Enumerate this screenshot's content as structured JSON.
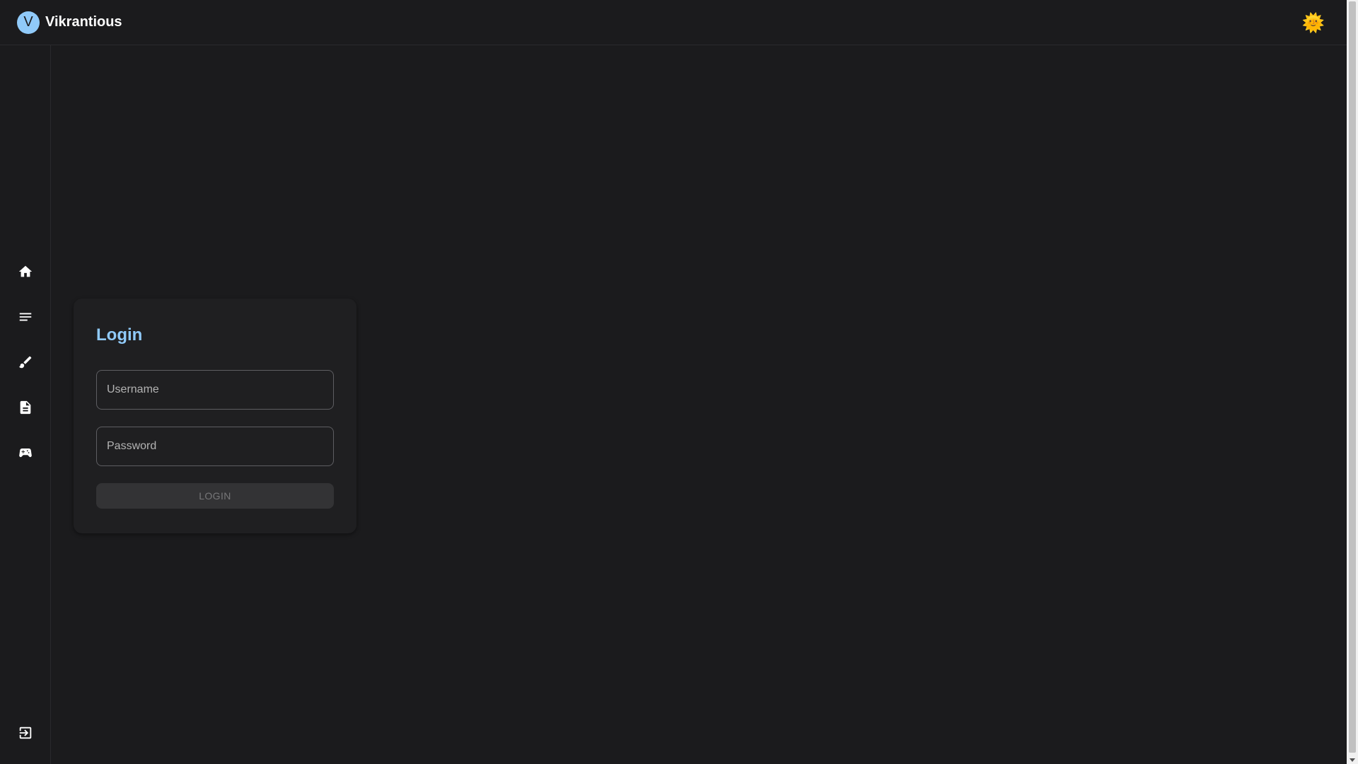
{
  "header": {
    "brand_initial": "V",
    "brand_name": "Vikrantious",
    "theme_toggle_icon": "sun-icon",
    "theme_toggle_glyph": "🌞"
  },
  "sidebar": {
    "items": [
      {
        "name": "home",
        "icon": "home-icon"
      },
      {
        "name": "posts",
        "icon": "notes-icon"
      },
      {
        "name": "art",
        "icon": "brush-icon"
      },
      {
        "name": "documents",
        "icon": "document-icon"
      },
      {
        "name": "games",
        "icon": "gamepad-icon"
      }
    ],
    "footer_item": {
      "name": "logout",
      "icon": "logout-icon"
    }
  },
  "login": {
    "title": "Login",
    "username_placeholder": "Username",
    "username_value": "",
    "password_placeholder": "Password",
    "password_value": "",
    "submit_label": "LOGIN",
    "submit_disabled": true
  },
  "colors": {
    "background": "#1b1b1d",
    "card": "#1f1f21",
    "accent": "#90caf9",
    "button_disabled_bg": "#333335",
    "button_disabled_text": "#777779"
  }
}
